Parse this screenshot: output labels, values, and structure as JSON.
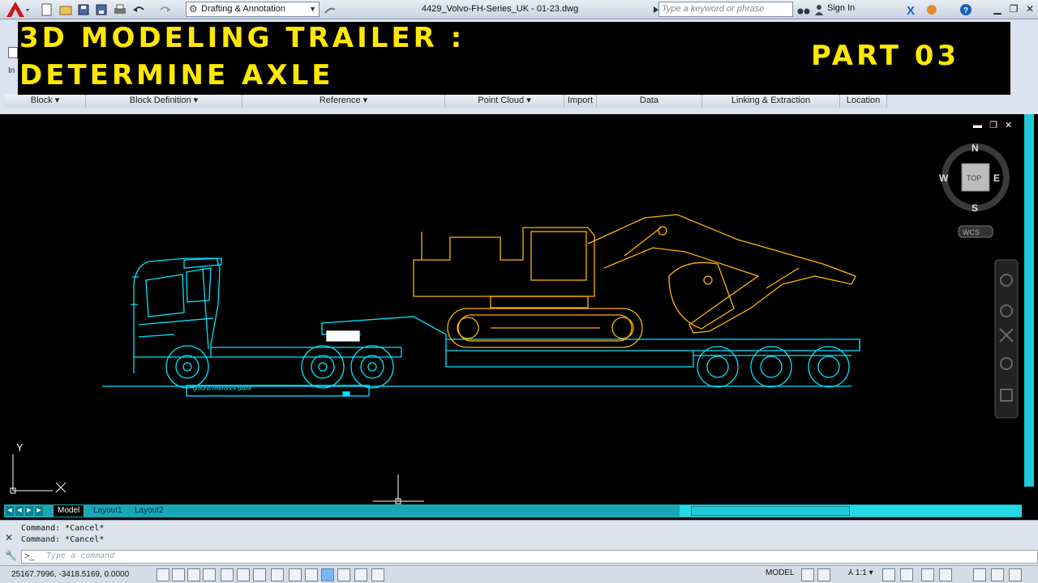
{
  "window": {
    "doc_title": "4429_Volvo-FH-Series_UK - 01-23.dwg",
    "workspace": "Drafting & Annotation",
    "search_placeholder": "Type a keyword or phrase",
    "sign_in": "Sign In"
  },
  "ribbon": {
    "panels": [
      "Block",
      "Block Definition",
      "Reference",
      "Point Cloud",
      "Import",
      "Data",
      "Linking & Extraction",
      "Location"
    ]
  },
  "overlay": {
    "title_line1": "3D MODELING TRAILER :",
    "title_line2": "DETERMINE AXLE",
    "part": "PART 03"
  },
  "drawing": {
    "ground_label": "ground reference plane",
    "ucs_y": "Y",
    "ucs_x": "X"
  },
  "viewcube": {
    "north": "N",
    "south": "S",
    "east": "E",
    "west": "W",
    "face": "TOP",
    "wcs": "WCS"
  },
  "tabs": [
    "Model",
    "Layout1",
    "Layout2"
  ],
  "command": {
    "history": [
      "Command: *Cancel*",
      "Command: *Cancel*"
    ],
    "placeholder": "Type a command"
  },
  "status": {
    "coords": "25167.7996, -3418.5169, 0.0000",
    "model": "MODEL",
    "scale": "1:1"
  },
  "colors": {
    "truck": "#00e5ff",
    "excavator": "#ffb400",
    "overlay_text": "#ffe800"
  }
}
